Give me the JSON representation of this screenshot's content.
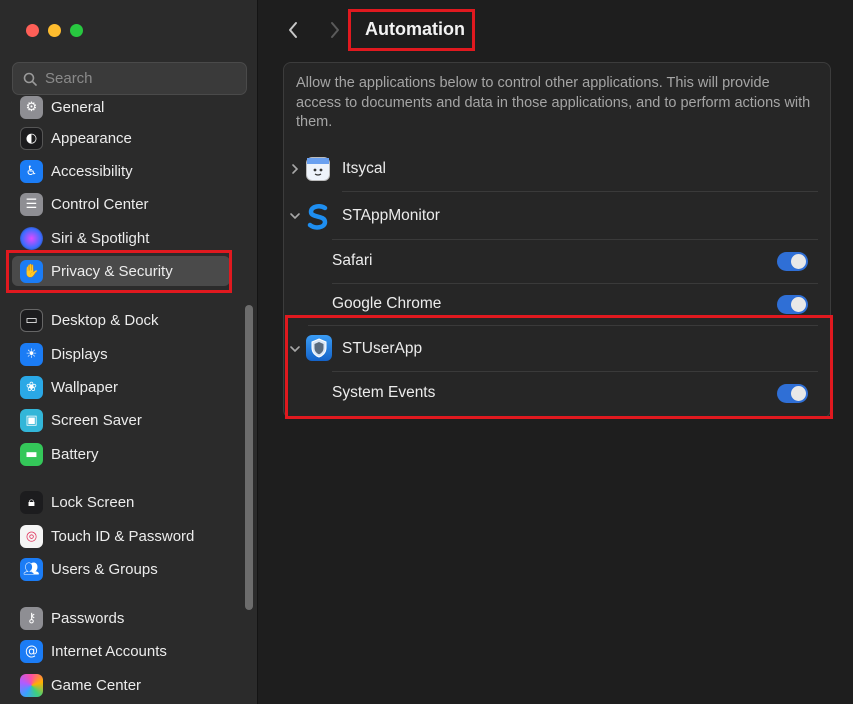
{
  "window": {
    "title": "Automation"
  },
  "search": {
    "placeholder": "Search"
  },
  "sidebar": {
    "items": [
      {
        "label": "General",
        "icon": "gear-icon"
      },
      {
        "label": "Appearance",
        "icon": "appearance-icon"
      },
      {
        "label": "Accessibility",
        "icon": "accessibility-icon"
      },
      {
        "label": "Control Center",
        "icon": "control-center-icon"
      },
      {
        "label": "Siri & Spotlight",
        "icon": "siri-icon"
      },
      {
        "label": "Privacy & Security",
        "icon": "hand-icon",
        "selected": true
      },
      {
        "label": "Desktop & Dock",
        "icon": "desktop-dock-icon"
      },
      {
        "label": "Displays",
        "icon": "sun-icon"
      },
      {
        "label": "Wallpaper",
        "icon": "flower-icon"
      },
      {
        "label": "Screen Saver",
        "icon": "screen-saver-icon"
      },
      {
        "label": "Battery",
        "icon": "battery-icon"
      },
      {
        "label": "Lock Screen",
        "icon": "lock-icon"
      },
      {
        "label": "Touch ID & Password",
        "icon": "fingerprint-icon"
      },
      {
        "label": "Users & Groups",
        "icon": "users-icon"
      },
      {
        "label": "Passwords",
        "icon": "key-icon"
      },
      {
        "label": "Internet Accounts",
        "icon": "at-icon"
      },
      {
        "label": "Game Center",
        "icon": "game-center-icon"
      }
    ]
  },
  "main": {
    "description": "Allow the applications below to control other applications. This will provide access to documents and data in those applications, and to perform actions with them.",
    "apps": [
      {
        "name": "Itsycal",
        "expanded": false,
        "targets": []
      },
      {
        "name": "STAppMonitor",
        "expanded": true,
        "targets": [
          {
            "name": "Safari",
            "enabled": true
          },
          {
            "name": "Google Chrome",
            "enabled": true
          }
        ]
      },
      {
        "name": "STUserApp",
        "expanded": true,
        "targets": [
          {
            "name": "System Events",
            "enabled": true
          }
        ]
      }
    ]
  },
  "colors": {
    "accent": "#2f6fd6",
    "highlight": "#e0191f"
  }
}
